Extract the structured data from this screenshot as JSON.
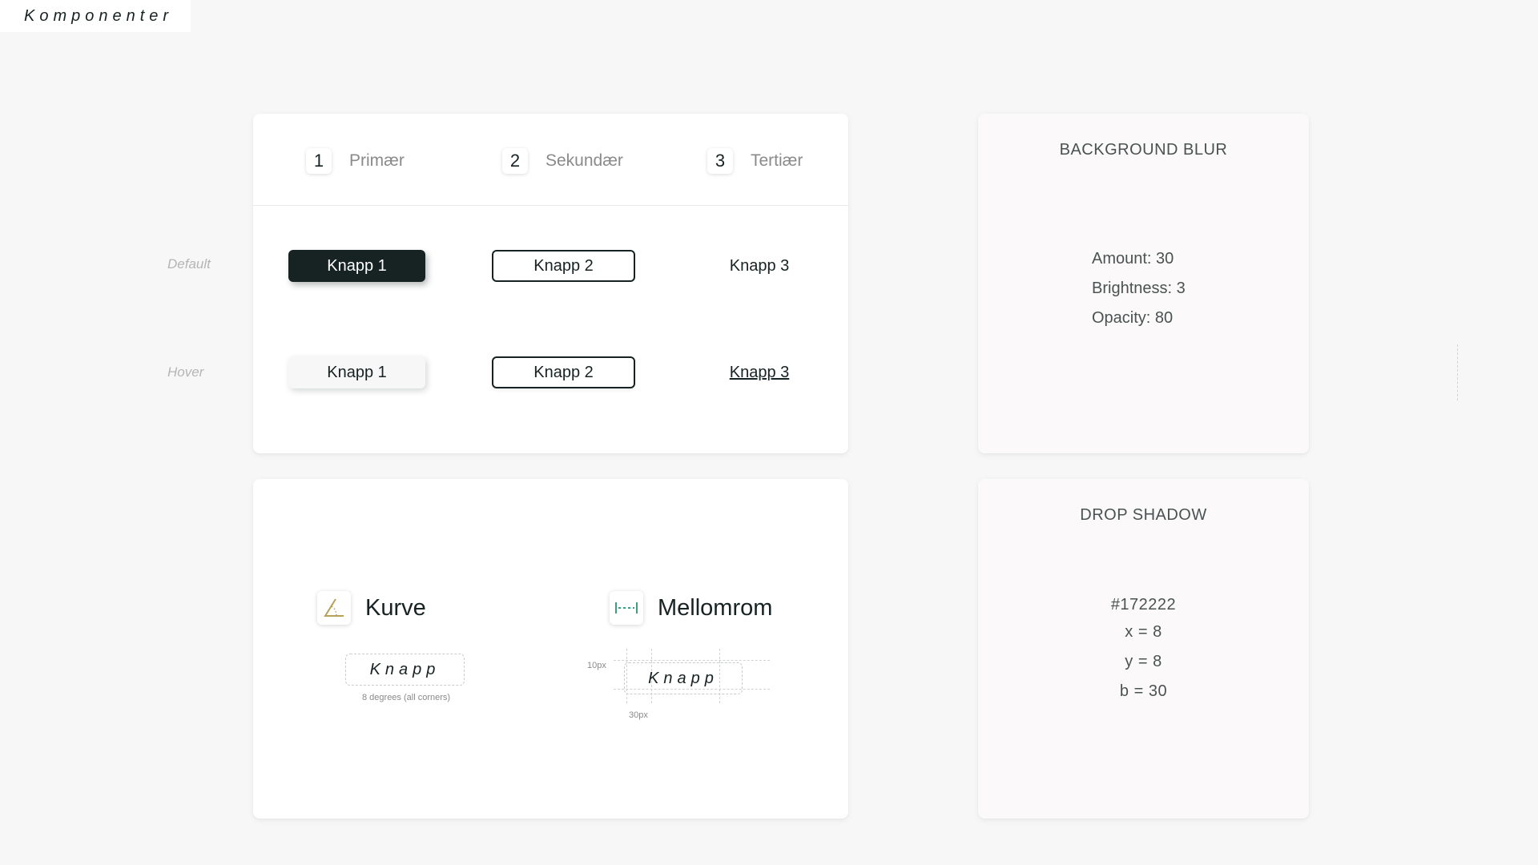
{
  "page": {
    "title": "Komponenter"
  },
  "buttons": {
    "tabs": [
      {
        "number": "1",
        "label": "Primær"
      },
      {
        "number": "2",
        "label": "Sekundær"
      },
      {
        "number": "3",
        "label": "Tertiær"
      }
    ],
    "row_labels": {
      "default": "Default",
      "hover": "Hover"
    },
    "default": {
      "primary": "Knapp 1",
      "secondary": "Knapp 2",
      "tertiary": "Knapp 3"
    },
    "hover": {
      "primary": "Knapp 1",
      "secondary": "Knapp 2",
      "tertiary": "Knapp 3"
    }
  },
  "properties": {
    "curve": {
      "title": "Kurve",
      "icon": "angle-icon",
      "demo_label": "Knapp",
      "note": "8 degrees (all corners)"
    },
    "spacing": {
      "title": "Mellomrom",
      "icon": "spacing-icon",
      "demo_label": "Knapp",
      "vertical_label": "10px",
      "horizontal_label": "30px"
    }
  },
  "background_blur": {
    "title": "BACKGROUND BLUR",
    "lines": [
      "Amount: 30",
      "Brightness: 3",
      "Opacity: 80"
    ]
  },
  "drop_shadow": {
    "title": "DROP SHADOW",
    "lines": [
      "#172222",
      "x = 8",
      "y = 8",
      "b = 30"
    ]
  },
  "colors": {
    "primary": "#172222",
    "background": "#f7f7f7",
    "card": "#ffffff",
    "card_pink": "#fbf9f9",
    "curve_icon": "#b6a05a",
    "spacing_icon": "#3f9e82"
  }
}
